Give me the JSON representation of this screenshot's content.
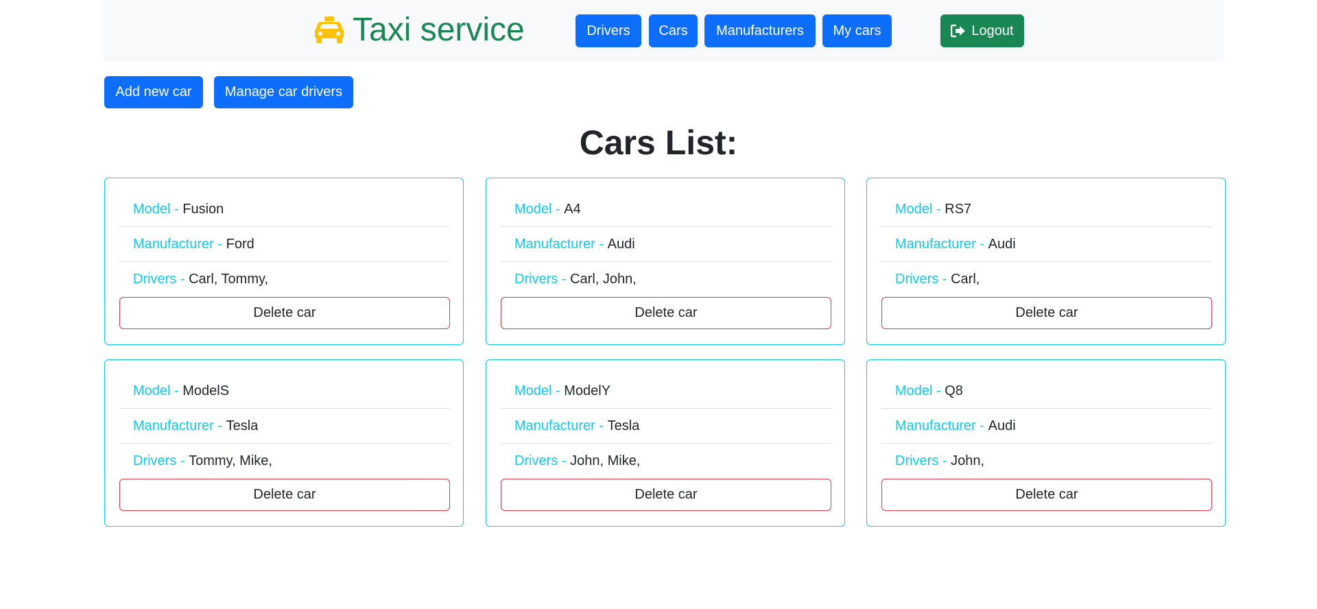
{
  "navbar": {
    "brand": "Taxi service",
    "brand_icon": "taxi-icon",
    "links": [
      "Drivers",
      "Cars",
      "Manufacturers",
      "My cars"
    ],
    "logout_label": "Logout",
    "logout_icon": "sign-out-icon"
  },
  "actions": {
    "add_car_label": "Add new car",
    "manage_drivers_label": "Manage car drivers"
  },
  "page_title": "Cars List:",
  "labels": {
    "model": "Model - ",
    "manufacturer": "Manufacturer - ",
    "drivers": "Drivers - ",
    "delete": "Delete car"
  },
  "cars": [
    {
      "model": "Fusion",
      "manufacturer": "Ford",
      "drivers": "Carl, Tommy,"
    },
    {
      "model": "A4",
      "manufacturer": "Audi",
      "drivers": "Carl, John,"
    },
    {
      "model": "RS7",
      "manufacturer": "Audi",
      "drivers": "Carl,"
    },
    {
      "model": "ModelS",
      "manufacturer": "Tesla",
      "drivers": "Tommy, Mike,"
    },
    {
      "model": "ModelY",
      "manufacturer": "Tesla",
      "drivers": "John, Mike,"
    },
    {
      "model": "Q8",
      "manufacturer": "Audi",
      "drivers": "John,"
    }
  ],
  "colors": {
    "primary": "#0d6efd",
    "success": "#198754",
    "info": "#0dcaf0",
    "danger": "#dc3545",
    "taxi": "#ffc107"
  }
}
